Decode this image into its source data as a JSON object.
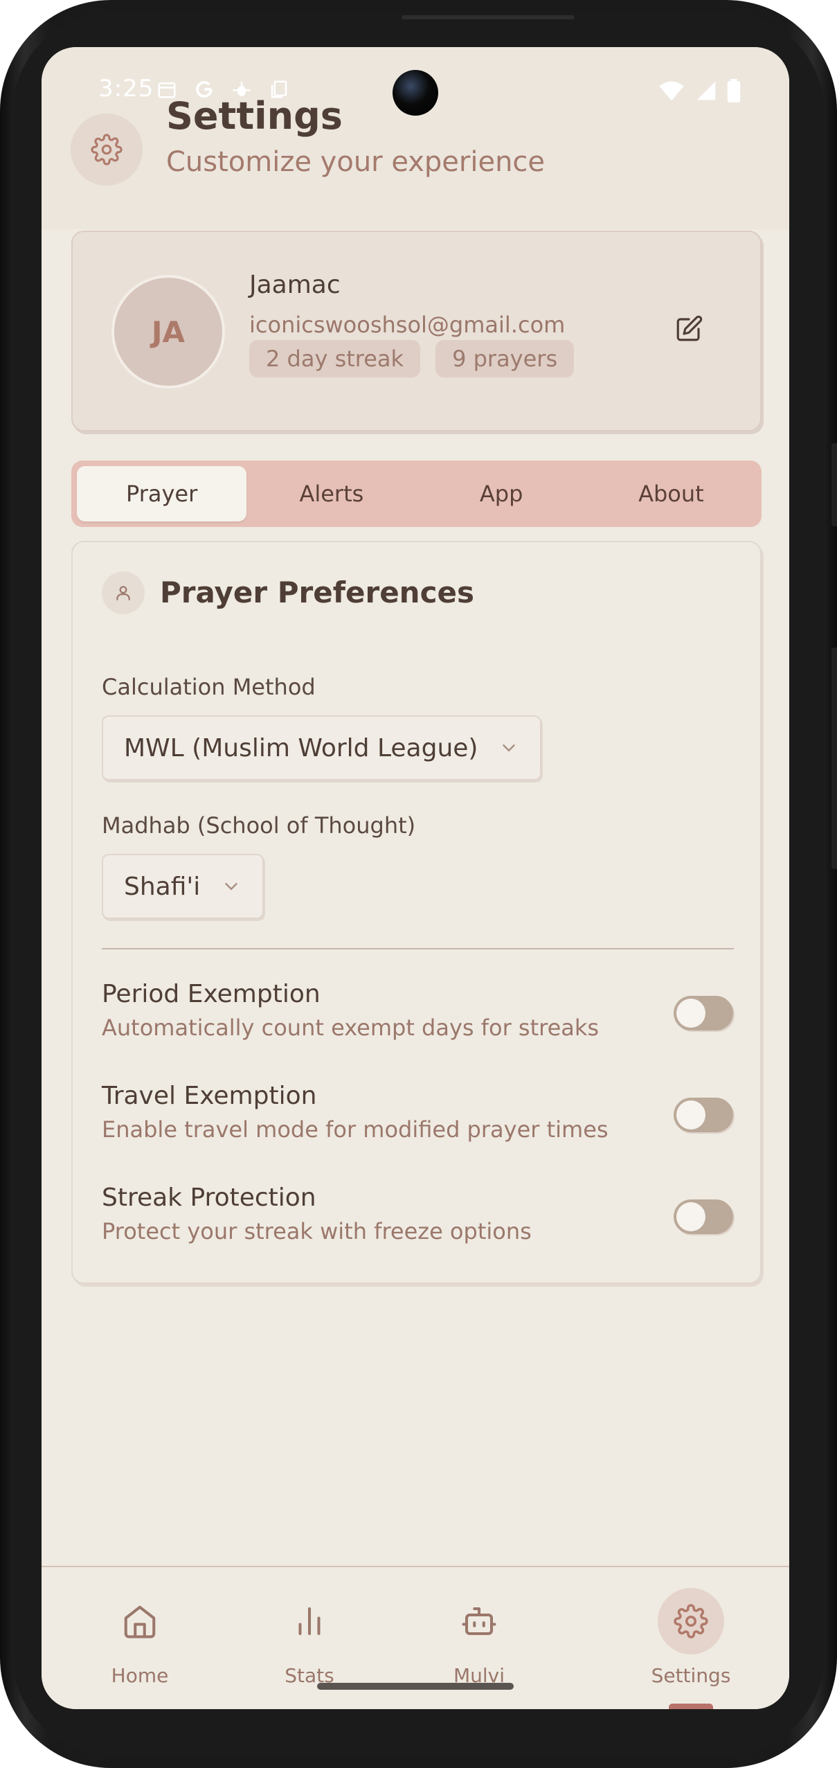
{
  "status_bar": {
    "time": "3:25"
  },
  "header": {
    "title": "Settings",
    "subtitle": "Customize your experience"
  },
  "profile": {
    "initials": "JA",
    "name": "Jaamac",
    "email": "iconicswooshsol@gmail.com",
    "streak_chip": "2 day streak",
    "prayers_chip": "9 prayers"
  },
  "tabs": [
    {
      "label": "Prayer",
      "active": true
    },
    {
      "label": "Alerts",
      "active": false
    },
    {
      "label": "App",
      "active": false
    },
    {
      "label": "About",
      "active": false
    }
  ],
  "prayer_preferences": {
    "title": "Prayer Preferences",
    "calculation_method": {
      "label": "Calculation Method",
      "value": "MWL (Muslim World League)"
    },
    "madhab": {
      "label": "Madhab (School of Thought)",
      "value": "Shafi'i"
    },
    "options": [
      {
        "title": "Period Exemption",
        "description": "Automatically count exempt days for streaks",
        "enabled": false
      },
      {
        "title": "Travel Exemption",
        "description": "Enable travel mode for modified prayer times",
        "enabled": false
      },
      {
        "title": "Streak Protection",
        "description": "Protect your streak with freeze options",
        "enabled": false
      }
    ]
  },
  "bottom_nav": [
    {
      "label": "Home",
      "icon": "home-icon",
      "active": false
    },
    {
      "label": "Stats",
      "icon": "bar-chart-icon",
      "active": false
    },
    {
      "label": "Mulvi",
      "icon": "robot-icon",
      "active": false
    },
    {
      "label": "Settings",
      "icon": "gear-icon",
      "active": true
    }
  ],
  "colors": {
    "background": "#efebe2",
    "accent": "#b8726a",
    "text_primary": "#4e3e36",
    "text_secondary": "#9b776b",
    "tab_bar": "#e6c0b6"
  }
}
